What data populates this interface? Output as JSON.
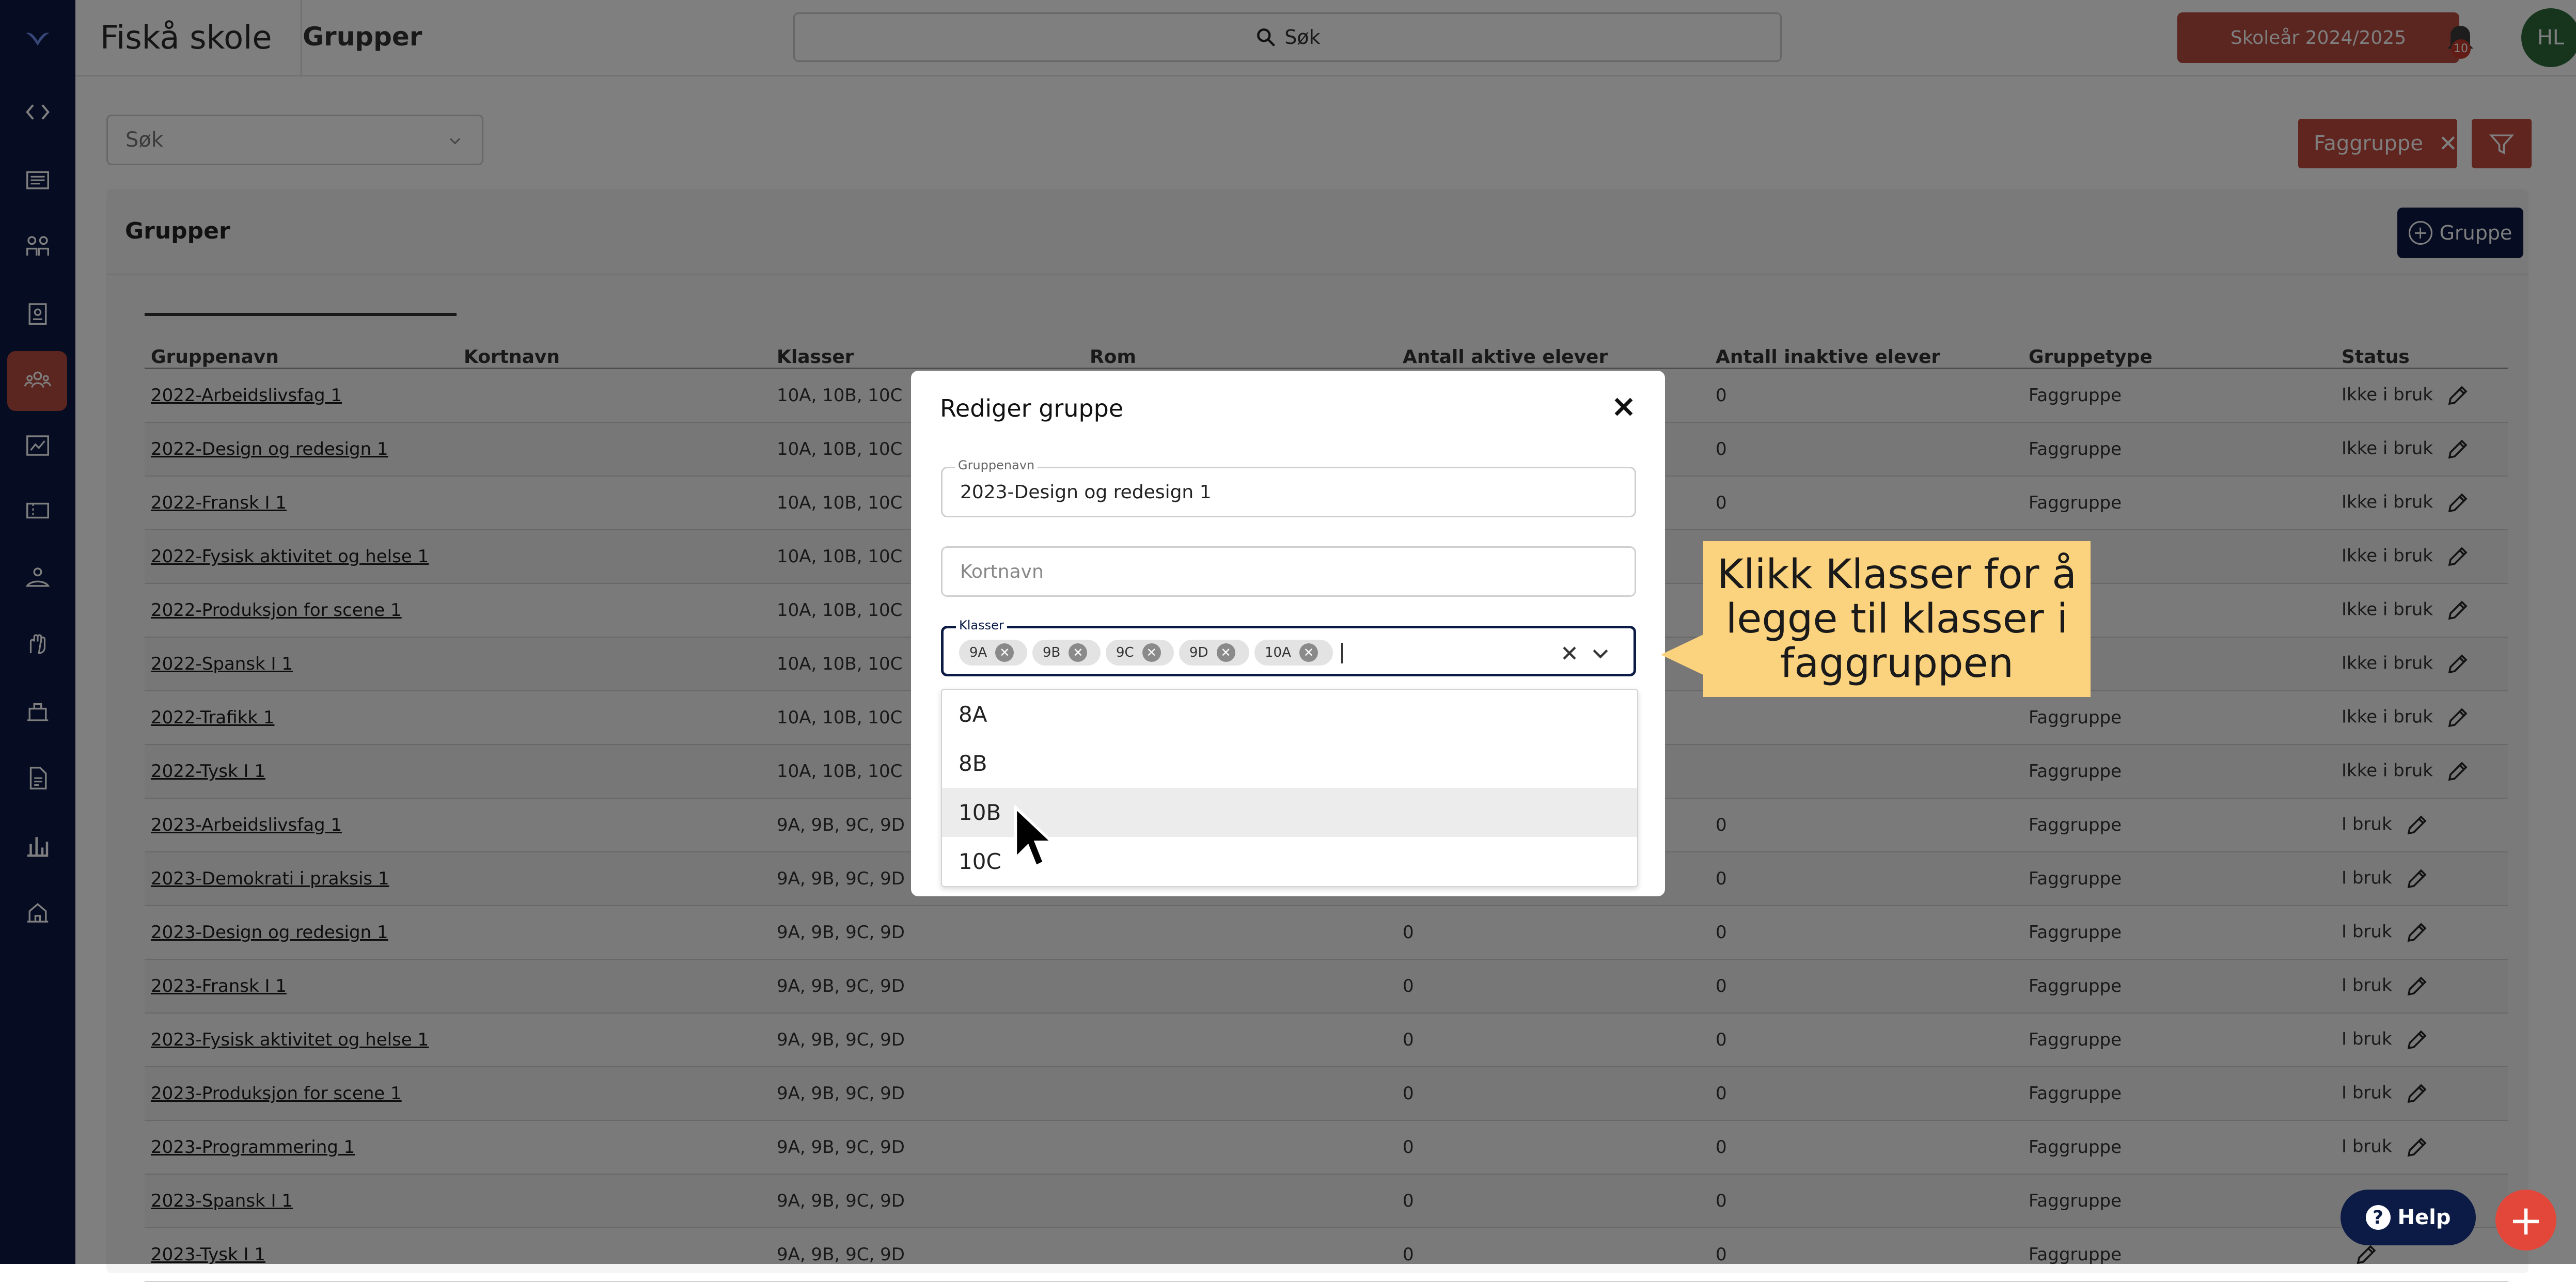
{
  "topbar": {
    "school_name": "Fiskå skole",
    "page_title": "Grupper",
    "search_label": "Søk",
    "year_button": "Skoleår 2024/2025",
    "notification_count": "10",
    "avatar_initials": "HL"
  },
  "filters": {
    "search_placeholder": "Søk",
    "active_chip": "Faggruppe"
  },
  "card": {
    "title": "Grupper",
    "add_button": "Gruppe"
  },
  "table": {
    "headers": [
      "Gruppenavn",
      "Kortnavn",
      "Klasser",
      "Rom",
      "Antall aktive elever",
      "Antall inaktive elever",
      "Gruppetype",
      "Status"
    ],
    "rows": [
      {
        "name": "2022-Arbeidslivsfag 1",
        "kortnavn": "",
        "klasser": "10A, 10B, 10C",
        "rom": "",
        "aktive": "",
        "inaktive": "0",
        "type": "Faggruppe",
        "status": "Ikke i bruk"
      },
      {
        "name": "2022-Design og redesign 1",
        "kortnavn": "",
        "klasser": "10A, 10B, 10C",
        "rom": "",
        "aktive": "",
        "inaktive": "0",
        "type": "Faggruppe",
        "status": "Ikke i bruk"
      },
      {
        "name": "2022-Fransk I 1",
        "kortnavn": "",
        "klasser": "10A, 10B, 10C",
        "rom": "",
        "aktive": "",
        "inaktive": "0",
        "type": "Faggruppe",
        "status": "Ikke i bruk"
      },
      {
        "name": "2022-Fysisk aktivitet og helse 1",
        "kortnavn": "",
        "klasser": "10A, 10B, 10C",
        "rom": "",
        "aktive": "",
        "inaktive": "",
        "type": "",
        "status": "Ikke i bruk"
      },
      {
        "name": "2022-Produksjon for scene 1",
        "kortnavn": "",
        "klasser": "10A, 10B, 10C",
        "rom": "",
        "aktive": "",
        "inaktive": "",
        "type": "",
        "status": "Ikke i bruk"
      },
      {
        "name": "2022-Spansk I 1",
        "kortnavn": "",
        "klasser": "10A, 10B, 10C",
        "rom": "",
        "aktive": "",
        "inaktive": "",
        "type": "",
        "status": "Ikke i bruk"
      },
      {
        "name": "2022-Trafikk 1",
        "kortnavn": "",
        "klasser": "10A, 10B, 10C",
        "rom": "",
        "aktive": "",
        "inaktive": "",
        "type": "Faggruppe",
        "status": "Ikke i bruk"
      },
      {
        "name": "2022-Tysk I 1",
        "kortnavn": "",
        "klasser": "10A, 10B, 10C",
        "rom": "",
        "aktive": "",
        "inaktive": "",
        "type": "Faggruppe",
        "status": "Ikke i bruk"
      },
      {
        "name": "2023-Arbeidslivsfag 1",
        "kortnavn": "",
        "klasser": "9A, 9B, 9C, 9D",
        "rom": "",
        "aktive": "",
        "inaktive": "0",
        "type": "Faggruppe",
        "status": "I bruk"
      },
      {
        "name": "2023-Demokrati i praksis 1",
        "kortnavn": "",
        "klasser": "9A, 9B, 9C, 9D",
        "rom": "",
        "aktive": "",
        "inaktive": "0",
        "type": "Faggruppe",
        "status": "I bruk"
      },
      {
        "name": "2023-Design og redesign 1",
        "kortnavn": "",
        "klasser": "9A, 9B, 9C, 9D",
        "rom": "",
        "aktive": "0",
        "inaktive": "0",
        "type": "Faggruppe",
        "status": "I bruk"
      },
      {
        "name": "2023-Fransk I 1",
        "kortnavn": "",
        "klasser": "9A, 9B, 9C, 9D",
        "rom": "",
        "aktive": "0",
        "inaktive": "0",
        "type": "Faggruppe",
        "status": "I bruk"
      },
      {
        "name": "2023-Fysisk aktivitet og helse 1",
        "kortnavn": "",
        "klasser": "9A, 9B, 9C, 9D",
        "rom": "",
        "aktive": "0",
        "inaktive": "0",
        "type": "Faggruppe",
        "status": "I bruk"
      },
      {
        "name": "2023-Produksjon for scene 1",
        "kortnavn": "",
        "klasser": "9A, 9B, 9C, 9D",
        "rom": "",
        "aktive": "0",
        "inaktive": "0",
        "type": "Faggruppe",
        "status": "I bruk"
      },
      {
        "name": "2023-Programmering 1",
        "kortnavn": "",
        "klasser": "9A, 9B, 9C, 9D",
        "rom": "",
        "aktive": "0",
        "inaktive": "0",
        "type": "Faggruppe",
        "status": "I bruk"
      },
      {
        "name": "2023-Spansk I 1",
        "kortnavn": "",
        "klasser": "9A, 9B, 9C, 9D",
        "rom": "",
        "aktive": "0",
        "inaktive": "0",
        "type": "Faggruppe",
        "status": ""
      },
      {
        "name": "2023-Tysk I 1",
        "kortnavn": "",
        "klasser": "9A, 9B, 9C, 9D",
        "rom": "",
        "aktive": "0",
        "inaktive": "0",
        "type": "Faggruppe",
        "status": ""
      }
    ]
  },
  "modal": {
    "title": "Rediger gruppe",
    "gruppenavn_label": "Gruppenavn",
    "gruppenavn_value": "2023-Design og redesign 1",
    "kortnavn_placeholder": "Kortnavn",
    "klasser_label": "Klasser",
    "selected_tags": [
      "9A",
      "9B",
      "9C",
      "9D",
      "10A"
    ],
    "options": [
      "8A",
      "8B",
      "10B",
      "10C"
    ]
  },
  "callout": {
    "text": "Klikk Klasser for å legge til klasser i faggruppen"
  },
  "help_button": "Help",
  "colors": {
    "navy": "#0c1b45",
    "brand_red": "#b64a40",
    "callout_yellow": "#fbd27e"
  }
}
